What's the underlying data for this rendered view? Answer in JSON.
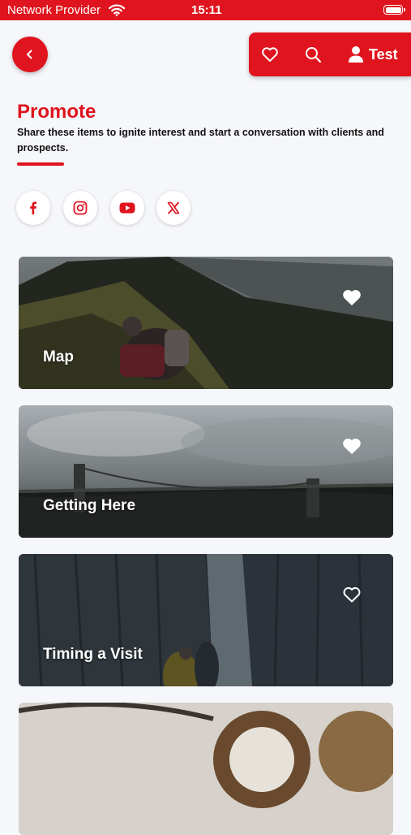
{
  "status_bar": {
    "provider": "Network Provider",
    "time": "15:11"
  },
  "nav": {
    "user_label": "Test"
  },
  "header": {
    "title": "Promote",
    "subtitle": "Share these items to ignite interest and start a conversation with clients and prospects."
  },
  "social": [
    "facebook-icon",
    "instagram-icon",
    "youtube-icon",
    "x-icon"
  ],
  "cards": [
    {
      "label": "Map",
      "favorited": true
    },
    {
      "label": "Getting Here",
      "favorited": true
    },
    {
      "label": "Timing a Visit",
      "favorited": false
    },
    {
      "label": "",
      "favorited": false
    }
  ],
  "colors": {
    "accent": "#e0141e",
    "background": "#f6f7fb"
  }
}
